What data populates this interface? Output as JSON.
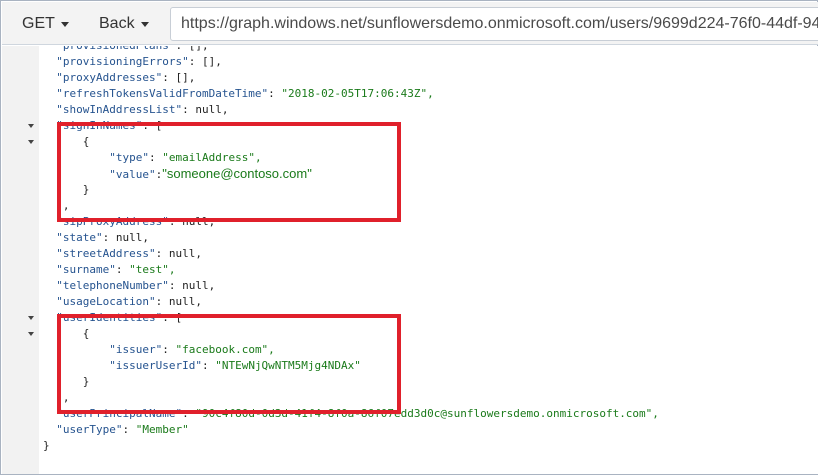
{
  "toolbar": {
    "method_label": "GET",
    "back_label": "Back",
    "url": "https://graph.windows.net/sunflowersdemo.onmicrosoft.com/users/9699d224-76f0-44df-94"
  },
  "json_lines": [
    {
      "indent": "  ",
      "key": "\"provisionedPlans\"",
      "sep": ": ",
      "value": "[],",
      "value_type": "plain"
    },
    {
      "indent": "  ",
      "key": "\"provisioningErrors\"",
      "sep": ": ",
      "value": "[],",
      "value_type": "plain"
    },
    {
      "indent": "  ",
      "key": "\"proxyAddresses\"",
      "sep": ": ",
      "value": "[],",
      "value_type": "plain"
    },
    {
      "indent": "  ",
      "key": "\"refreshTokensValidFromDateTime\"",
      "sep": ": ",
      "value": "\"2018-02-05T17:06:43Z\",",
      "value_type": "string"
    },
    {
      "indent": "  ",
      "key": "\"showInAddressList\"",
      "sep": ": ",
      "value": "null,",
      "value_type": "plain"
    },
    {
      "indent": "  ",
      "key": "\"signInNames\"",
      "sep": ": ",
      "value": "[",
      "value_type": "plain",
      "fold": true
    },
    {
      "indent": "      ",
      "key": "",
      "sep": "",
      "value": "{",
      "value_type": "plain",
      "fold": true
    },
    {
      "indent": "          ",
      "key": "\"type\"",
      "sep": ": ",
      "value": "\"emailAddress\",",
      "value_type": "string"
    },
    {
      "indent": "          ",
      "key": "\"value\"",
      "sep": ":",
      "value": "\"someone@contoso.com\"",
      "value_type": "string-large"
    },
    {
      "indent": "      ",
      "key": "",
      "sep": "",
      "value": "}",
      "value_type": "plain"
    },
    {
      "indent": "  ",
      "key": "",
      "sep": "",
      "value": "],",
      "value_type": "plain"
    },
    {
      "indent": "  ",
      "key": "\"sipProxyAddress\"",
      "sep": ": ",
      "value": "null,",
      "value_type": "plain"
    },
    {
      "indent": "  ",
      "key": "\"state\"",
      "sep": ": ",
      "value": "null,",
      "value_type": "plain"
    },
    {
      "indent": "  ",
      "key": "\"streetAddress\"",
      "sep": ": ",
      "value": "null,",
      "value_type": "plain"
    },
    {
      "indent": "  ",
      "key": "\"surname\"",
      "sep": ": ",
      "value": "\"test\",",
      "value_type": "string"
    },
    {
      "indent": "  ",
      "key": "\"telephoneNumber\"",
      "sep": ": ",
      "value": "null,",
      "value_type": "plain"
    },
    {
      "indent": "  ",
      "key": "\"usageLocation\"",
      "sep": ": ",
      "value": "null,",
      "value_type": "plain"
    },
    {
      "indent": "  ",
      "key": "\"userIdentities\"",
      "sep": ": ",
      "value": "[",
      "value_type": "plain",
      "fold": true
    },
    {
      "indent": "      ",
      "key": "",
      "sep": "",
      "value": "{",
      "value_type": "plain",
      "fold": true
    },
    {
      "indent": "          ",
      "key": "\"issuer\"",
      "sep": ": ",
      "value": "\"facebook.com\",",
      "value_type": "string"
    },
    {
      "indent": "          ",
      "key": "\"issuerUserId\"",
      "sep": ": ",
      "value": "\"NTEwNjQwNTM5Mjg4NDAx\"",
      "value_type": "string"
    },
    {
      "indent": "      ",
      "key": "",
      "sep": "",
      "value": "}",
      "value_type": "plain"
    },
    {
      "indent": "  ",
      "key": "",
      "sep": "",
      "value": "],",
      "value_type": "plain"
    },
    {
      "indent": "  ",
      "key": "\"userPrincipalName\"",
      "sep": ": ",
      "value": "\"90c4f80d-0d3d-41f4-8f0a-86f07edd3d0c@sunflowersdemo.onmicrosoft.com\",",
      "value_type": "string"
    },
    {
      "indent": "  ",
      "key": "\"userType\"",
      "sep": ": ",
      "value": "\"Member\"",
      "value_type": "string"
    },
    {
      "indent": "",
      "key": "",
      "sep": "",
      "value": "}",
      "value_type": "plain"
    }
  ],
  "colors": {
    "key": "#25538f",
    "string": "#1a7a1a",
    "highlight": "#e0202b"
  }
}
